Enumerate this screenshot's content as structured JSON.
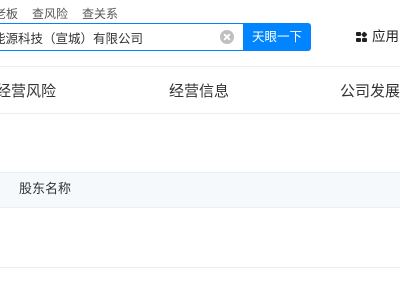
{
  "search": {
    "tabs": [
      "老板",
      "查风险",
      "查关系"
    ],
    "query": "能源科技（宣城）有限公司",
    "submit_label": "天眼一下"
  },
  "header": {
    "app_label": "应用"
  },
  "nav": {
    "items": [
      "经营风险",
      "经营信息",
      "公司发展"
    ]
  },
  "table": {
    "columns": [
      "股东名称"
    ]
  },
  "colors": {
    "accent": "#0084ff",
    "table_header_bg": "#f5f9fc"
  }
}
